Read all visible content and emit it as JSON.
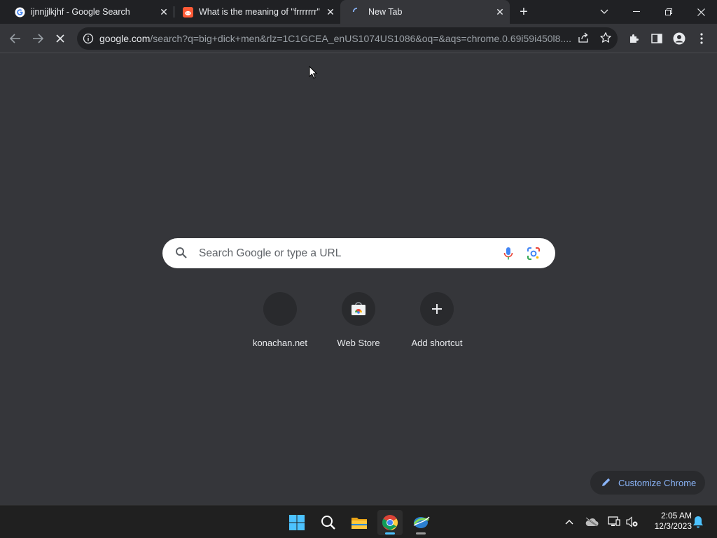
{
  "browser": {
    "tabs": [
      {
        "title": "ijnnjjlkjhf - Google Search",
        "favicon": "google-g-icon",
        "active": false
      },
      {
        "title": "What is the meaning of \"frrrrrrr\"",
        "favicon": "reddit-icon",
        "active": false
      },
      {
        "title": "New Tab",
        "favicon": "loading-spinner-icon",
        "active": true
      }
    ],
    "new_tab_label": "+",
    "url_host": "google.com",
    "url_path": "/search?q=big+dick+men&rlz=1C1GCEA_enUS1074US1086&oq=&aqs=chrome.0.69i59i450l8...."
  },
  "ntp": {
    "search_placeholder": "Search Google or type a URL",
    "shortcuts": [
      {
        "label": "konachan.net",
        "icon": "blank-favicon"
      },
      {
        "label": "Web Store",
        "icon": "chrome-web-store-icon"
      },
      {
        "label": "Add shortcut",
        "icon": "plus-icon"
      }
    ],
    "customize_label": "Customize Chrome"
  },
  "taskbar": {
    "apps": [
      "windows-start-icon",
      "search-icon",
      "file-explorer-icon",
      "chrome-icon",
      "app-icon"
    ],
    "time": "2:05 AM",
    "date": "12/3/2023"
  },
  "colors": {
    "accent_link": "#8ab4f8",
    "frame": "#202124",
    "toolbar": "#35363a",
    "taskbar": "#202020"
  }
}
